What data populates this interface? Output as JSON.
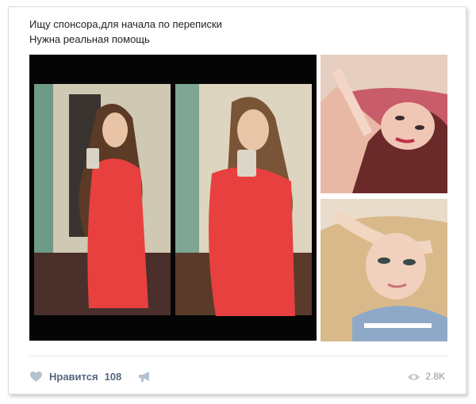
{
  "post": {
    "text_line1": "Ищу спонсора,для начала по переписки",
    "text_line2": "Нужна реальная помощь"
  },
  "photos": [
    {
      "name": "main-collage-photo",
      "alt": ""
    },
    {
      "name": "side-photo-top",
      "alt": ""
    },
    {
      "name": "side-photo-bottom",
      "alt": ""
    }
  ],
  "footer": {
    "like_label": "Нравится",
    "like_count": "108",
    "views_count": "2.8K"
  },
  "icons": {
    "like": "heart-icon",
    "share": "megaphone-icon",
    "views": "eye-icon"
  },
  "colors": {
    "accent": "#55677d",
    "icon_gray": "#b7c2cf",
    "views_gray": "#939393",
    "dress_red": "#e8403f"
  }
}
